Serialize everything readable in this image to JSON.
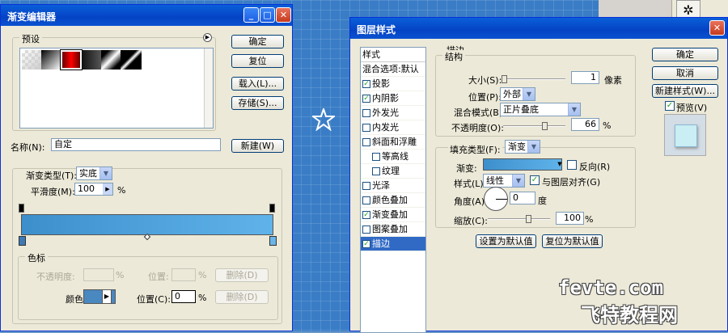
{
  "gradient_editor": {
    "title": "渐变编辑器",
    "presets_label": "预设",
    "ok": "确定",
    "reset": "复位",
    "load": "载入(L)...",
    "save": "存储(S)...",
    "name_label": "名称(N):",
    "name_value": "自定",
    "new_button": "新建(W)",
    "type_label": "渐变类型(T):",
    "type_value": "实底",
    "smooth_label": "平滑度(M):",
    "smooth_value": "100",
    "percent": "%",
    "stops_legend": "色标",
    "opacity_label": "不透明度:",
    "location_label": "位置:",
    "delete_label": "删除(D)",
    "color_label": "颜色:",
    "location2_label": "位置(C):",
    "location2_value": "0",
    "colors": {
      "start": "#3d8fcc",
      "end": "#5fb3ea"
    }
  },
  "layer_style": {
    "title": "图层样式",
    "styles_header": "样式",
    "items": [
      {
        "label": "混合选项:默认",
        "check": null
      },
      {
        "label": "投影",
        "check": true
      },
      {
        "label": "内阴影",
        "check": true
      },
      {
        "label": "外发光",
        "check": false
      },
      {
        "label": "内发光",
        "check": false
      },
      {
        "label": "斜面和浮雕",
        "check": false
      },
      {
        "label": "等高线",
        "check": false
      },
      {
        "label": "纹理",
        "check": false
      },
      {
        "label": "光泽",
        "check": false
      },
      {
        "label": "颜色叠加",
        "check": false
      },
      {
        "label": "渐变叠加",
        "check": true
      },
      {
        "label": "图案叠加",
        "check": false
      },
      {
        "label": "描边",
        "check": true
      }
    ],
    "stroke_title": "描边",
    "structure_legend": "结构",
    "size_label": "大小(S):",
    "size_value": "1",
    "size_unit": "像素",
    "position_label": "位置(P):",
    "position_value": "外部",
    "blend_label": "混合模式(B):",
    "blend_value": "正片叠底",
    "opacity_label": "不透明度(O):",
    "opacity_value": "66",
    "percent": "%",
    "fill_type_label": "填充类型(F):",
    "fill_type_value": "渐变",
    "gradient_label": "渐变:",
    "reverse_label": "反向(R)",
    "style_label": "样式(L):",
    "style_value": "线性",
    "align_label": "与图层对齐(G)",
    "angle_label": "角度(A):",
    "angle_value": "0",
    "angle_unit": "度",
    "scale_label": "缩放(C):",
    "scale_value": "100",
    "set_default": "设置为默认值",
    "reset_default": "复位为默认值",
    "ok": "确定",
    "cancel": "取消",
    "new_style": "新建样式(W)...",
    "preview_label": "预览(V)"
  },
  "watermark": {
    "line1": "fevte.com",
    "line2": "飞特教程网"
  }
}
